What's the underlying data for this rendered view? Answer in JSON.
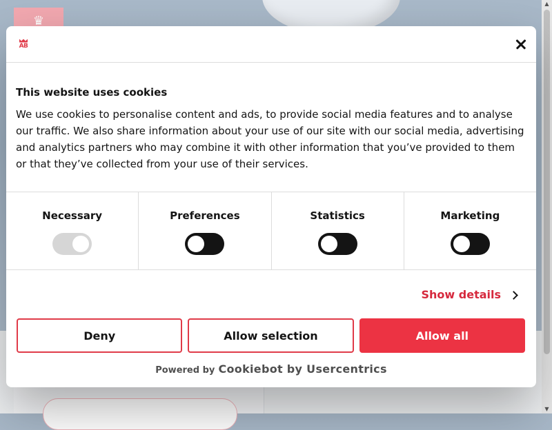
{
  "background": {
    "logo_symbol": "♛"
  },
  "dialog": {
    "brand_logo_text": "AB",
    "close_icon": "close-icon",
    "title": "This website uses cookies",
    "description": "We use cookies to personalise content and ads, to provide social media features and to analyse our traffic. We also share information about your use of our site with our social media, advertising and analytics partners who may combine it with other information that you’ve provided to them or that they’ve collected from your use of their services.",
    "categories": [
      {
        "label": "Necessary",
        "enabled": true,
        "locked": true
      },
      {
        "label": "Preferences",
        "enabled": false,
        "locked": false
      },
      {
        "label": "Statistics",
        "enabled": false,
        "locked": false
      },
      {
        "label": "Marketing",
        "enabled": false,
        "locked": false
      }
    ],
    "show_details": "Show details",
    "buttons": {
      "deny": "Deny",
      "allow_selection": "Allow selection",
      "allow_all": "Allow all"
    },
    "powered_by": "Powered by",
    "provider": "Cookiebot by Usercentrics"
  },
  "colors": {
    "accent": "#ec3343",
    "link": "#d6293d",
    "text": "#141414"
  }
}
